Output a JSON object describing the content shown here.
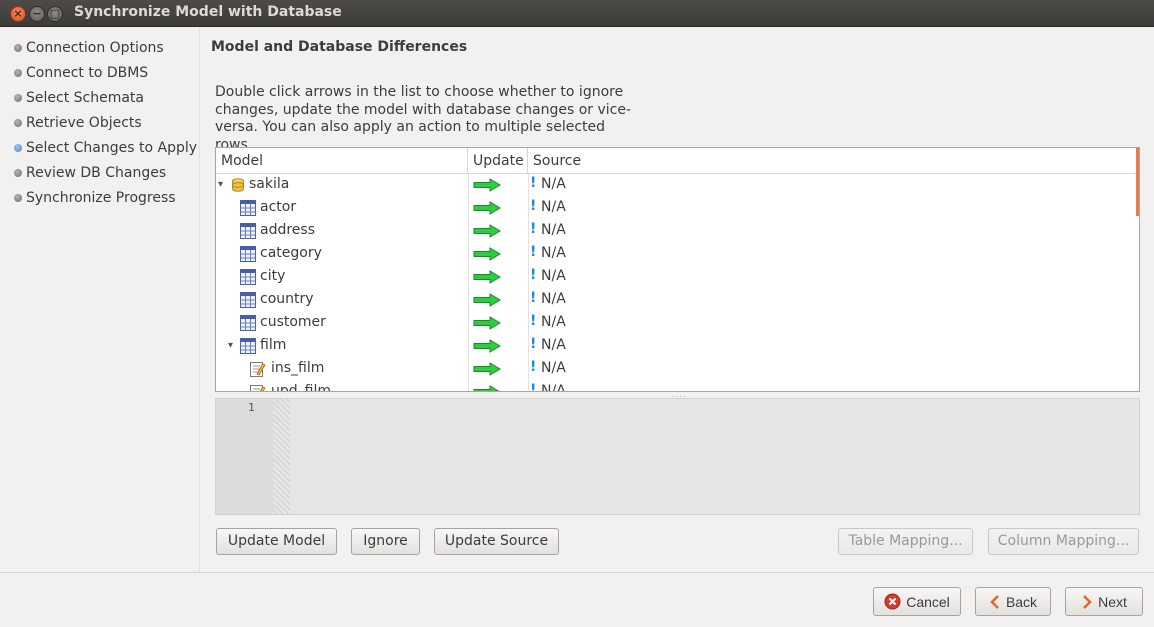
{
  "window": {
    "title": "Synchronize Model with Database"
  },
  "steps": [
    {
      "label": "Connection Options",
      "active": false
    },
    {
      "label": "Connect to DBMS",
      "active": false
    },
    {
      "label": "Select Schemata",
      "active": false
    },
    {
      "label": "Retrieve Objects",
      "active": false
    },
    {
      "label": "Select Changes to Apply",
      "active": true
    },
    {
      "label": "Review DB Changes",
      "active": false
    },
    {
      "label": "Synchronize Progress",
      "active": false
    }
  ],
  "main": {
    "title": "Model and Database Differences",
    "description": "Double click arrows in the list to choose whether to ignore changes, update the model with database changes or vice-versa. You can also apply an action to multiple selected rows.",
    "columns": {
      "model": "Model",
      "update": "Update",
      "source": "Source"
    },
    "rows": [
      {
        "label": "sakila",
        "icon": "database-icon",
        "expander": "▾",
        "source": "N/A"
      },
      {
        "label": "actor",
        "icon": "table-icon",
        "source": "N/A"
      },
      {
        "label": "address",
        "icon": "table-icon",
        "source": "N/A"
      },
      {
        "label": "category",
        "icon": "table-icon",
        "source": "N/A"
      },
      {
        "label": "city",
        "icon": "table-icon",
        "source": "N/A"
      },
      {
        "label": "country",
        "icon": "table-icon",
        "source": "N/A"
      },
      {
        "label": "customer",
        "icon": "table-icon",
        "source": "N/A"
      },
      {
        "label": "film",
        "icon": "table-icon",
        "expander": "▾",
        "source": "N/A"
      },
      {
        "label": "ins_film",
        "icon": "trigger-icon",
        "source": "N/A"
      },
      {
        "label": "upd_film",
        "icon": "trigger-icon",
        "source": "N/A"
      }
    ],
    "editor": {
      "line_number": "1"
    }
  },
  "actions": {
    "update_model": "Update Model",
    "ignore": "Ignore",
    "update_source": "Update Source",
    "table_mapping": "Table Mapping...",
    "column_mapping": "Column Mapping..."
  },
  "footer": {
    "cancel": "Cancel",
    "back": "Back",
    "next": "Next"
  },
  "colors": {
    "arrow": "#2ecc40",
    "info": "#1a8fd6",
    "accent": "#f07746"
  }
}
